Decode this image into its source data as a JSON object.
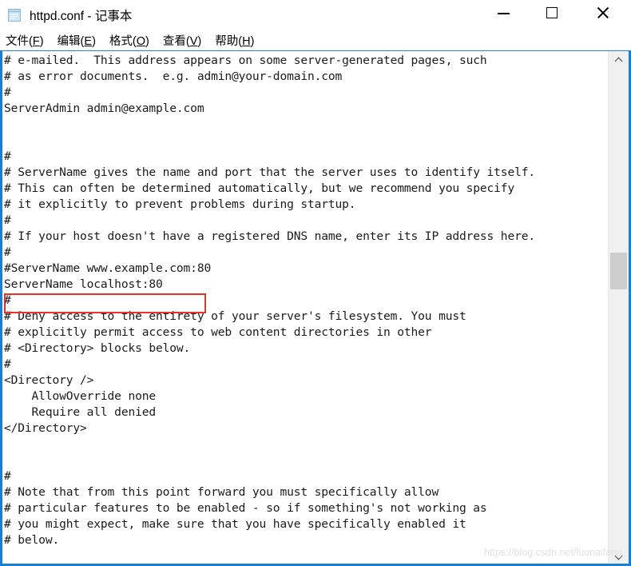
{
  "window": {
    "title": "httpd.conf - 记事本",
    "icon": "notepad-icon"
  },
  "titlebar": {
    "minimize_label": "—",
    "maximize_label": "□",
    "close_label": "✕"
  },
  "menubar": {
    "items": [
      {
        "label": "文件",
        "accel": "F"
      },
      {
        "label": "编辑",
        "accel": "E"
      },
      {
        "label": "格式",
        "accel": "O"
      },
      {
        "label": "查看",
        "accel": "V"
      },
      {
        "label": "帮助",
        "accel": "H"
      }
    ]
  },
  "editor": {
    "content": "# e-mailed.  This address appears on some server-generated pages, such\n# as error documents.  e.g. admin@your-domain.com\n#\nServerAdmin admin@example.com\n\n\n#\n# ServerName gives the name and port that the server uses to identify itself.\n# This can often be determined automatically, but we recommend you specify\n# it explicitly to prevent problems during startup.\n#\n# If your host doesn't have a registered DNS name, enter its IP address here.\n#\n#ServerName www.example.com:80\nServerName localhost:80\n#\n# Deny access to the entirety of your server's filesystem. You must\n# explicitly permit access to web content directories in other\n# <Directory> blocks below.\n#\n<Directory />\n    AllowOverride none\n    Require all denied\n</Directory>\n\n\n#\n# Note that from this point forward you must specifically allow\n# particular features to be enabled - so if something's not working as\n# you might expect, make sure that you have specifically enabled it\n# below."
  },
  "annotation": {
    "highlighted_text": "ServerName localhost:80",
    "color": "#e8312a"
  },
  "scrollbar": {
    "up_arrow": "chevron-up",
    "down_arrow": "chevron-down"
  },
  "watermark": {
    "text": "https://blog.csdn.net/luonaifang"
  }
}
